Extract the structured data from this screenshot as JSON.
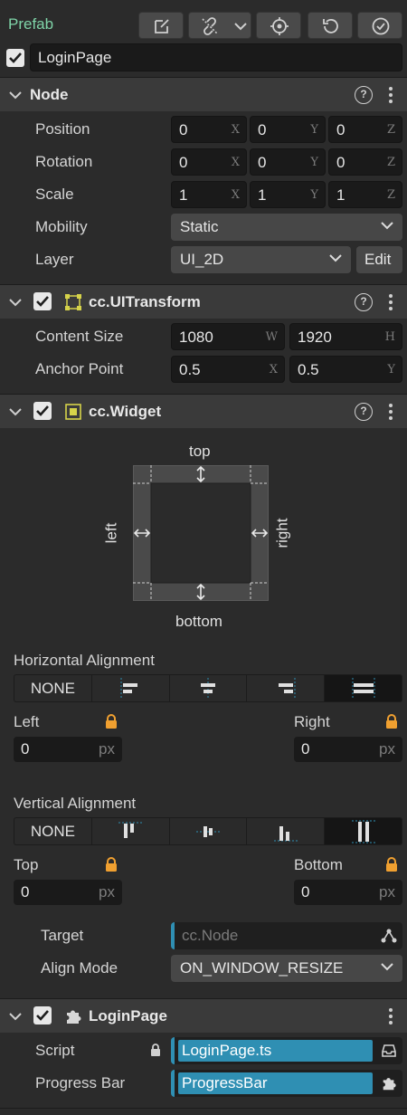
{
  "prefab": {
    "label": "Prefab",
    "node_name": "LoginPage"
  },
  "node": {
    "title": "Node",
    "position": {
      "label": "Position",
      "x": "0",
      "y": "0",
      "z": "0"
    },
    "rotation": {
      "label": "Rotation",
      "x": "0",
      "y": "0",
      "z": "0"
    },
    "scale": {
      "label": "Scale",
      "x": "1",
      "y": "1",
      "z": "1"
    },
    "mobility": {
      "label": "Mobility",
      "value": "Static"
    },
    "layer": {
      "label": "Layer",
      "value": "UI_2D",
      "edit_label": "Edit"
    },
    "axis": {
      "x": "X",
      "y": "Y",
      "z": "Z"
    }
  },
  "ui_transform": {
    "title": "cc.UITransform",
    "content_size": {
      "label": "Content Size",
      "w": "1080",
      "h": "1920",
      "w_axis": "W",
      "h_axis": "H"
    },
    "anchor_point": {
      "label": "Anchor Point",
      "x": "0.5",
      "y": "0.5"
    }
  },
  "widget": {
    "title": "cc.Widget",
    "diagram": {
      "top": "top",
      "bottom": "bottom",
      "left": "left",
      "right": "right"
    },
    "horizontal_alignment": {
      "label": "Horizontal Alignment",
      "none": "NONE",
      "selected_index": 4
    },
    "left": {
      "label": "Left",
      "value": "0",
      "unit": "px"
    },
    "right": {
      "label": "Right",
      "value": "0",
      "unit": "px"
    },
    "vertical_alignment": {
      "label": "Vertical Alignment",
      "none": "NONE",
      "selected_index": 4
    },
    "top": {
      "label": "Top",
      "value": "0",
      "unit": "px"
    },
    "bottom": {
      "label": "Bottom",
      "value": "0",
      "unit": "px"
    },
    "target": {
      "label": "Target",
      "placeholder": "cc.Node"
    },
    "align_mode": {
      "label": "Align Mode",
      "value": "ON_WINDOW_RESIZE"
    }
  },
  "login_page": {
    "title": "LoginPage",
    "script": {
      "label": "Script",
      "value": "LoginPage.ts"
    },
    "progress_bar": {
      "label": "Progress Bar",
      "value": "ProgressBar"
    }
  },
  "colors": {
    "prefab_green": "#7fd4a8",
    "asset_blue": "#2f8fb3",
    "lock_orange": "#f0a030",
    "component_icon_yellow": "#d6d34a"
  }
}
